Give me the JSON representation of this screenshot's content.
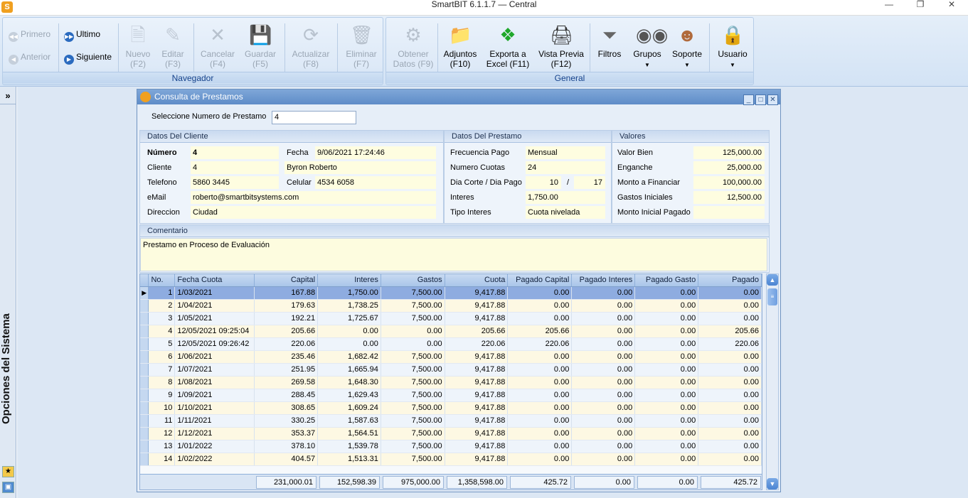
{
  "window": {
    "title": "SmartBIT 6.1.1.7 — Central"
  },
  "ribbon": {
    "nav": {
      "first": "Primero",
      "last": "Ultimo",
      "prev": "Anterior",
      "next": "Siguiente"
    },
    "buttons": {
      "nuevo": [
        "Nuevo",
        "(F2)"
      ],
      "editar": [
        "Editar",
        "(F3)"
      ],
      "cancelar": [
        "Cancelar",
        "(F4)"
      ],
      "guardar": [
        "Guardar",
        "(F5)"
      ],
      "actualizar": [
        "Actualizar",
        "(F8)"
      ],
      "eliminar": [
        "Eliminar",
        "(F7)"
      ],
      "obtener": [
        "Obtener",
        "Datos (F9)"
      ],
      "adjuntos": [
        "Adjuntos",
        "(F10)"
      ],
      "exporta": [
        "Exporta a",
        "Excel (F11)"
      ],
      "vista": [
        "Vista Previa",
        "(F12)"
      ],
      "filtros": "Filtros",
      "grupos": "Grupos",
      "soporte": "Soporte",
      "usuario": "Usuario"
    },
    "groups": {
      "navegador": "Navegador",
      "general": "General"
    }
  },
  "sidebar": {
    "label": "Opciones del Sistema",
    "expand": "»"
  },
  "form": {
    "title": "Consulta de Prestamos",
    "select_label": "Seleccione Numero de Prestamo",
    "select_value": "4",
    "cliente": {
      "header": "Datos Del Cliente",
      "numero_label": "Número",
      "numero": "4",
      "cliente_label": "Cliente",
      "cliente": "4",
      "telefono_label": "Telefono",
      "telefono": "5860 3445",
      "email_label": "eMail",
      "email": "roberto@smartbitsystems.com",
      "direccion_label": "Direccion",
      "direccion": "Ciudad",
      "fecha_label": "Fecha",
      "fecha": "9/06/2021 17:24:46",
      "nombre": "Byron Roberto",
      "celular_label": "Celular",
      "celular": "4534 6058"
    },
    "prestamo": {
      "header": "Datos Del Prestamo",
      "frecuencia_label": "Frecuencia Pago",
      "frecuencia": "Mensual",
      "cuotas_label": "Numero Cuotas",
      "cuotas": "24",
      "corte_label": "Dia Corte / Dia Pago",
      "corte": "10",
      "slash": "/",
      "pago": "17",
      "interes_label": "Interes",
      "interes": "1,750.00",
      "tipo_label": "Tipo Interes",
      "tipo": "Cuota nivelada"
    },
    "valores": {
      "header": "Valores",
      "valor_label": "Valor Bien",
      "valor": "125,000.00",
      "enganche_label": "Enganche",
      "enganche": "25,000.00",
      "monto_label": "Monto a Financiar",
      "monto": "100,000.00",
      "gastos_label": "Gastos Iniciales",
      "gastos": "12,500.00",
      "inicial_label": "Monto Inicial Pagado",
      "inicial": ""
    },
    "comentario": {
      "header": "Comentario",
      "text": "Prestamo en Proceso de Evaluación"
    }
  },
  "grid": {
    "columns": [
      "No.",
      "Fecha Cuota",
      "Capital",
      "Interes",
      "Gastos",
      "Cuota",
      "Pagado Capital",
      "Pagado Interes",
      "Pagado Gasto",
      "Pagado"
    ],
    "rows": [
      [
        "1",
        "1/03/2021",
        "167.88",
        "1,750.00",
        "7,500.00",
        "9,417.88",
        "0.00",
        "0.00",
        "0.00",
        "0.00"
      ],
      [
        "2",
        "1/04/2021",
        "179.63",
        "1,738.25",
        "7,500.00",
        "9,417.88",
        "0.00",
        "0.00",
        "0.00",
        "0.00"
      ],
      [
        "3",
        "1/05/2021",
        "192.21",
        "1,725.67",
        "7,500.00",
        "9,417.88",
        "0.00",
        "0.00",
        "0.00",
        "0.00"
      ],
      [
        "4",
        "12/05/2021 09:25:04",
        "205.66",
        "0.00",
        "0.00",
        "205.66",
        "205.66",
        "0.00",
        "0.00",
        "205.66"
      ],
      [
        "5",
        "12/05/2021 09:26:42",
        "220.06",
        "0.00",
        "0.00",
        "220.06",
        "220.06",
        "0.00",
        "0.00",
        "220.06"
      ],
      [
        "6",
        "1/06/2021",
        "235.46",
        "1,682.42",
        "7,500.00",
        "9,417.88",
        "0.00",
        "0.00",
        "0.00",
        "0.00"
      ],
      [
        "7",
        "1/07/2021",
        "251.95",
        "1,665.94",
        "7,500.00",
        "9,417.88",
        "0.00",
        "0.00",
        "0.00",
        "0.00"
      ],
      [
        "8",
        "1/08/2021",
        "269.58",
        "1,648.30",
        "7,500.00",
        "9,417.88",
        "0.00",
        "0.00",
        "0.00",
        "0.00"
      ],
      [
        "9",
        "1/09/2021",
        "288.45",
        "1,629.43",
        "7,500.00",
        "9,417.88",
        "0.00",
        "0.00",
        "0.00",
        "0.00"
      ],
      [
        "10",
        "1/10/2021",
        "308.65",
        "1,609.24",
        "7,500.00",
        "9,417.88",
        "0.00",
        "0.00",
        "0.00",
        "0.00"
      ],
      [
        "11",
        "1/11/2021",
        "330.25",
        "1,587.63",
        "7,500.00",
        "9,417.88",
        "0.00",
        "0.00",
        "0.00",
        "0.00"
      ],
      [
        "12",
        "1/12/2021",
        "353.37",
        "1,564.51",
        "7,500.00",
        "9,417.88",
        "0.00",
        "0.00",
        "0.00",
        "0.00"
      ],
      [
        "13",
        "1/01/2022",
        "378.10",
        "1,539.78",
        "7,500.00",
        "9,417.88",
        "0.00",
        "0.00",
        "0.00",
        "0.00"
      ],
      [
        "14",
        "1/02/2022",
        "404.57",
        "1,513.31",
        "7,500.00",
        "9,417.88",
        "0.00",
        "0.00",
        "0.00",
        "0.00"
      ]
    ],
    "totals": [
      "231,000.01",
      "152,598.39",
      "975,000.00",
      "1,358,598.00",
      "425.72",
      "0.00",
      "0.00",
      "425.72"
    ]
  }
}
